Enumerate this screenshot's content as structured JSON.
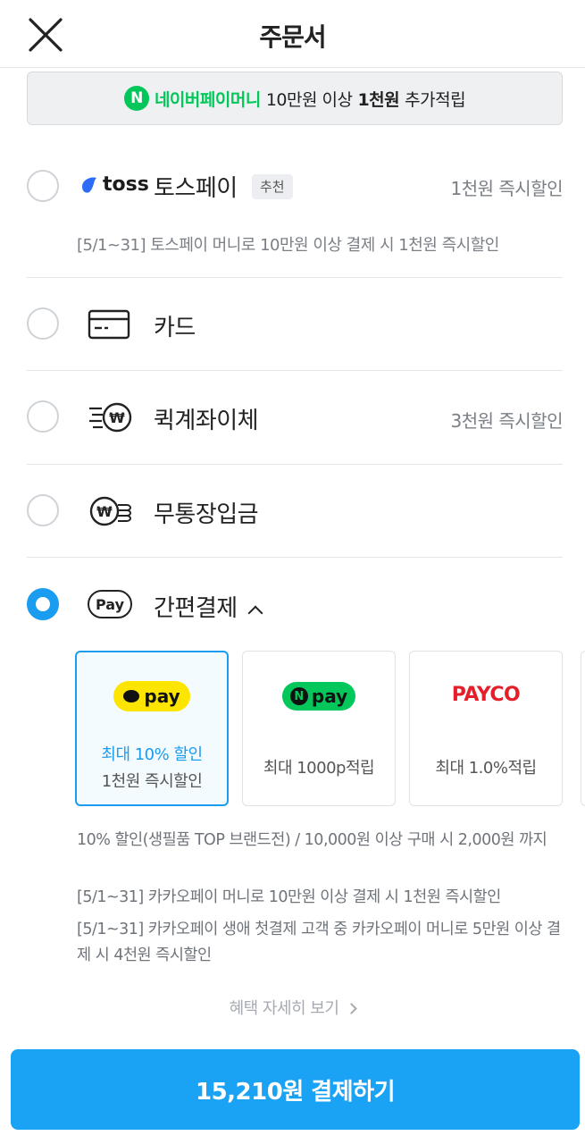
{
  "header": {
    "title": "주문서"
  },
  "promo": {
    "brand": "네이버페이머니",
    "text_before": "10만원 이상",
    "highlight": "1천원",
    "text_after": "추가적립",
    "brand_color": "#03c75a"
  },
  "payment_options": [
    {
      "logo_text": "toss",
      "label": "토스페이",
      "badge": "추천",
      "right": "1천원 즉시할인",
      "description": "[5/1~31] 토스페이 머니로 10만원 이상 결제 시 1천원 즉시할인",
      "selected": false
    },
    {
      "label": "카드",
      "icon": "credit-card-icon",
      "selected": false
    },
    {
      "label": "퀵계좌이체",
      "icon": "quick-transfer-icon",
      "right": "3천원 즉시할인",
      "selected": false
    },
    {
      "label": "무통장입금",
      "icon": "coins-icon",
      "selected": false
    },
    {
      "label": "간편결제",
      "icon": "pay-icon",
      "pay_text": "Pay",
      "selected": true
    }
  ],
  "easy_pay_cards": [
    {
      "brand": "kakao",
      "logo_text": "pay",
      "line1": "최대 10% 할인",
      "line2": "1천원 즉시할인",
      "selected": true
    },
    {
      "brand": "naver",
      "logo_text": "pay",
      "logo_n": "N",
      "line1": "최대 1000p적립",
      "selected": false
    },
    {
      "brand": "payco",
      "logo_text": "PAYCO",
      "line1": "최대 1.0%적립",
      "selected": false
    }
  ],
  "notes": [
    "10% 할인(생필품 TOP 브랜드전) / 10,000원 이상 구매 시 2,000원 까지",
    "[5/1~31] 카카오페이 머니로 10만원 이상 결제 시 1천원 즉시할인",
    "[5/1~31] 카카오페이 생애 첫결제 고객 중 카카오페이 머니로 5만원 이상 결제 시 4천원 즉시할인"
  ],
  "more_link": "혜택 자세히 보기",
  "pay_button": "15,210원 결제하기",
  "colors": {
    "accent": "#1aa3f5",
    "naver_green": "#03c75a",
    "kakao_yellow": "#fee500",
    "payco_red": "#e41f2a"
  }
}
